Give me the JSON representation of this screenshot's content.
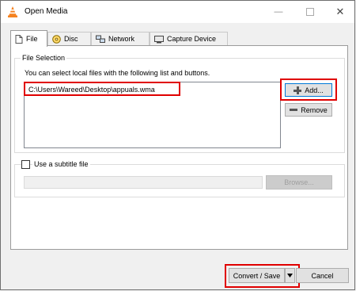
{
  "window": {
    "title": "Open Media",
    "accent": "#0078d7",
    "highlight_color": "#e00000"
  },
  "tabs": [
    {
      "label": "File",
      "icon": "file-icon"
    },
    {
      "label": "Disc",
      "icon": "disc-icon"
    },
    {
      "label": "Network",
      "icon": "network-icon"
    },
    {
      "label": "Capture Device",
      "icon": "capture-device-icon"
    }
  ],
  "file_selection": {
    "group_label": "File Selection",
    "description": "You can select local files with the following list and buttons.",
    "files": [
      "C:\\Users\\Wareed\\Desktop\\appuals.wma"
    ],
    "add_label": "Add...",
    "remove_label": "Remove"
  },
  "subtitle": {
    "checkbox_label": "Use a subtitle file",
    "checked": false,
    "browse_label": "Browse..."
  },
  "footer": {
    "convert_label": "Convert / Save",
    "cancel_label": "Cancel"
  }
}
